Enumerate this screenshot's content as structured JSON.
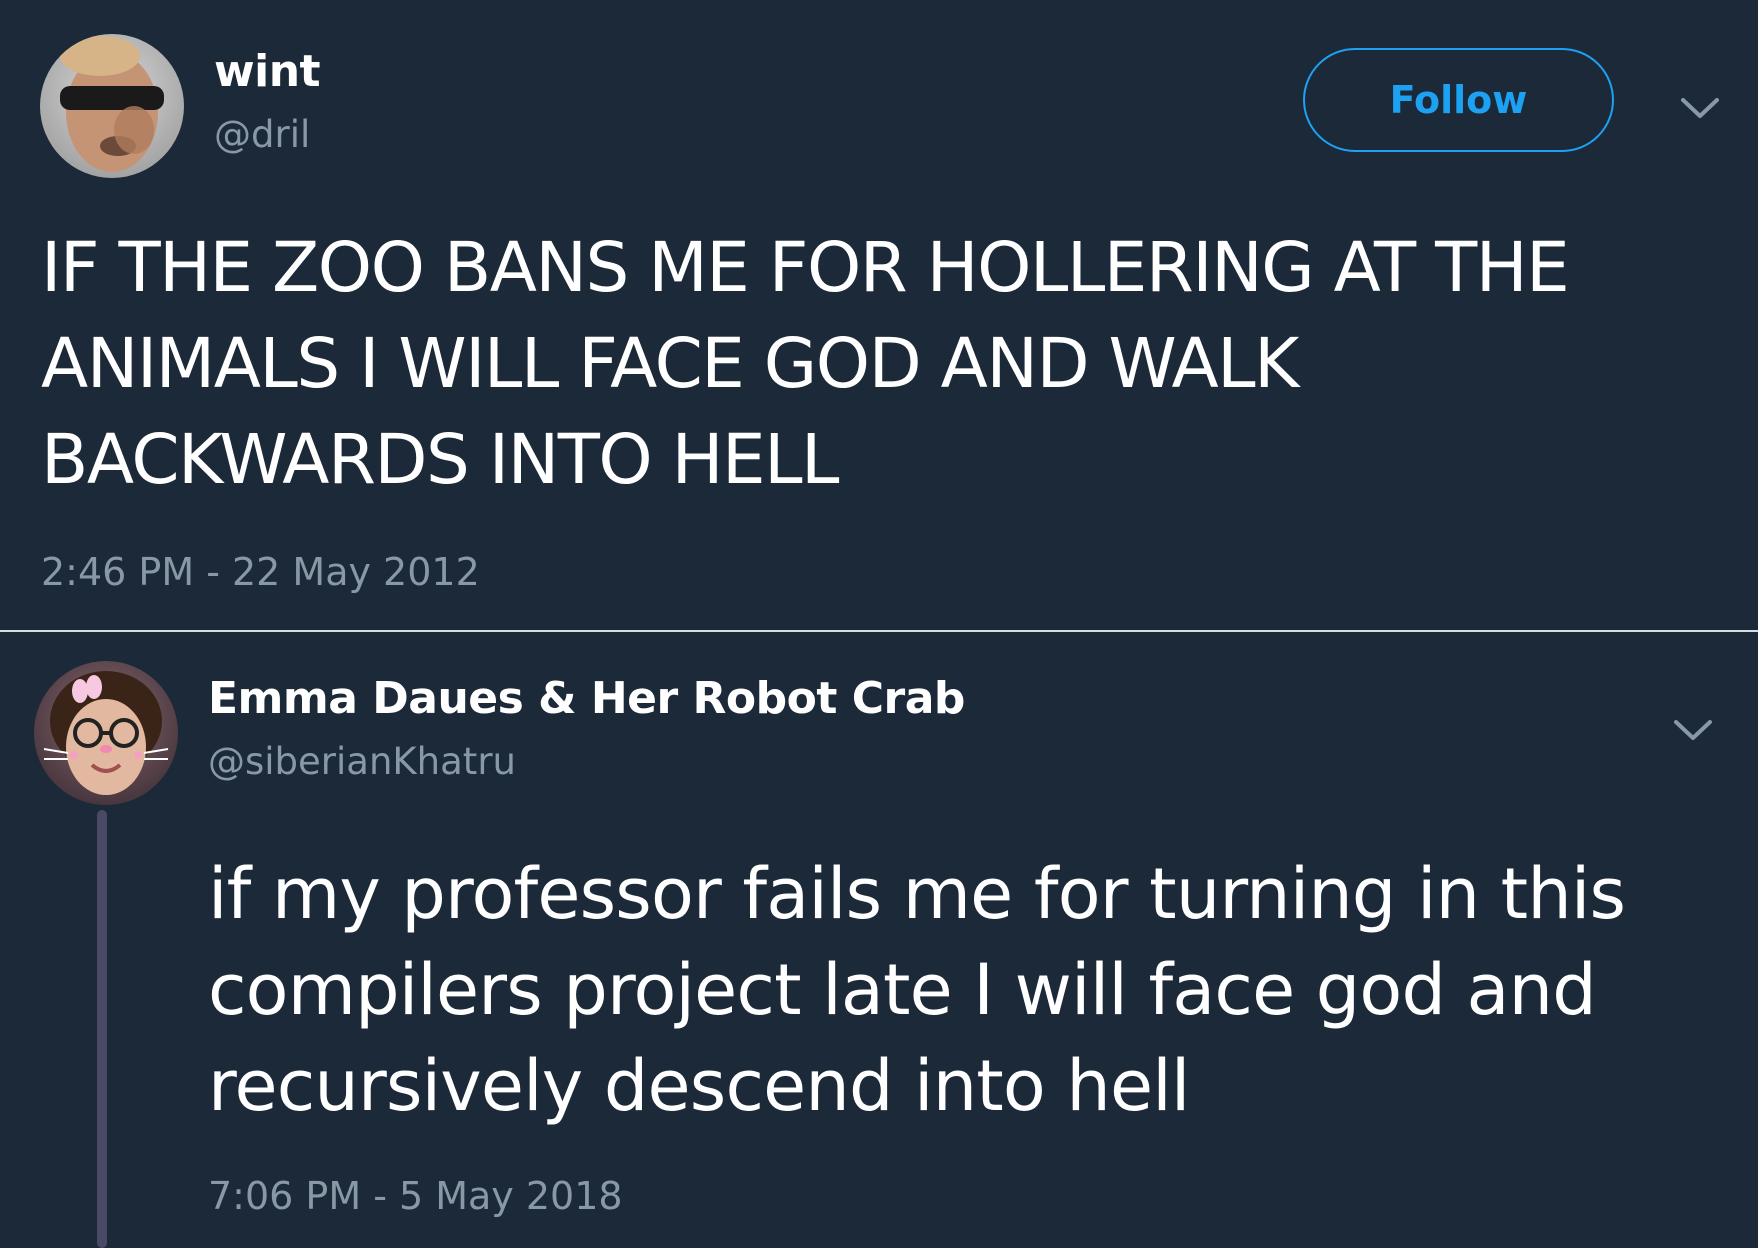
{
  "tweets": [
    {
      "display_name": "wint",
      "handle": "@dril",
      "follow_label": "Follow",
      "text": "IF THE ZOO BANS ME FOR HOLLERING AT THE ANIMALS I WILL FACE GOD AND WALK BACKWARDS INTO HELL",
      "timestamp": "2:46 PM - 22 May 2012",
      "menu_icon": "chevron-down-icon"
    },
    {
      "display_name": "Emma Daues & Her Robot Crab",
      "handle": "@siberianKhatru",
      "text": "if my professor fails me for turning in this compilers project late I will face god and recursively descend into hell",
      "timestamp": "7:06 PM - 5 May 2018",
      "menu_icon": "chevron-down-icon"
    }
  ],
  "colors": {
    "background": "#1c2938",
    "accent": "#1da1f2",
    "secondary_text": "#8899a6",
    "primary_text": "#ffffff",
    "thread_line": "#4b4a66"
  }
}
